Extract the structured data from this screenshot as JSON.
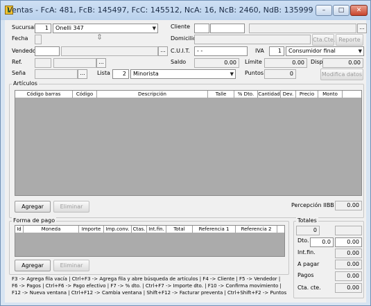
{
  "window": {
    "title": "Ventas - FcA: 481, FcB: 145497, FcC: 145512, NcA: 16, NcB: 2460, NdB: 135999",
    "minimize_glyph": "–",
    "maximize_glyph": "□",
    "close_glyph": "✕"
  },
  "form": {
    "sucursal_label": "Sucursal",
    "sucursal_code": "1",
    "sucursal_name": "Onelli 347",
    "fecha_label": "Fecha",
    "vendedor_label": "Vendedor",
    "ref_label": "Ref.",
    "sena_label": "Seña",
    "lista_label": "Lista",
    "lista_code": "2",
    "lista_name": "Minorista",
    "cliente_label": "Cliente",
    "domicilio_label": "Domicilio",
    "cuit_label": "C.U.I.T.",
    "cuit_value": " -        -",
    "iva_label": "IVA",
    "iva_code": "1",
    "iva_name": "Consumidor final",
    "saldo_label": "Saldo",
    "saldo_value": "0.00",
    "limite_label": "Límite",
    "limite_value": "0.00",
    "disp_label": "Disp.",
    "disp_value": "0.00",
    "puntos_label": "Puntos",
    "puntos_value": "0",
    "cta_cte_button": "Cta.Cte.",
    "reporte_button": "Reporte",
    "modifica_datos_button": "Modifica datos",
    "ellipsis": "..."
  },
  "articulos": {
    "group_label": "Artículos",
    "columns": [
      "Código barras",
      "Código",
      "Descripción",
      "Talle",
      "% Dto.",
      "Cantidad",
      "Dev.",
      "Precio",
      "Monto"
    ],
    "agregar_button": "Agregar",
    "eliminar_button": "Eliminar",
    "percepcion_label": "Percepción IIBB",
    "percepcion_value": "0.00"
  },
  "forma_pago": {
    "group_label": "Forma de pago",
    "columns": [
      "Id",
      "Moneda",
      "Importe",
      "Imp.conv.",
      "Ctas.",
      "Int.fin.",
      "Total",
      "Referencia 1",
      "Referencia 2"
    ],
    "agregar_button": "Agregar",
    "eliminar_button": "Eliminar"
  },
  "totales": {
    "group_label": "Totales",
    "subtotal_value": "0",
    "dto_label": "Dto.",
    "dto_pct": "0.0",
    "dto_value": "0.00",
    "intfin_label": "Int.fin.",
    "intfin_value": "0.00",
    "apagar_label": "A pagar",
    "apagar_value": "0.00",
    "pagos_label": "Pagos",
    "pagos_value": "0.00",
    "ctacte_label": "Cta. cte.",
    "ctacte_value": "0.00"
  },
  "help": {
    "line1": "F3 -> Agrega fila vacía  |  Ctrl+F3 -> Agrega fila y abre búsqueda de artículos  |  F4 -> Cliente  |  F5 -> Vendedor  |",
    "line2": "F6 -> Pagos  |  Ctrl+F6 -> Pago efectivo  |  F7 -> % dto.  |  Ctrl+F7 -> Importe dto.  |  F10 -> Confirma movimiento  |",
    "line3": "F12 -> Nueva ventana  |  Ctrl+F12 -> Cambia ventana  |  Shift+F12 -> Facturar preventa  |  Ctrl+Shift+F2 -> Puntos"
  }
}
